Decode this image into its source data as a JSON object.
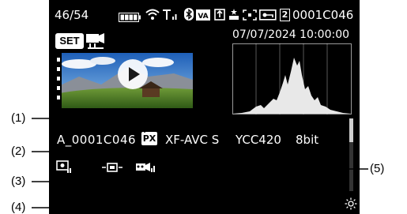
{
  "status_bar": {
    "image_counter": "46/54",
    "card_slot": "2",
    "file_id": "0001C046"
  },
  "datetime": "07/07/2024 10:00:00",
  "thumbnail": {
    "set_label": "SET"
  },
  "details": {
    "file_name": "A_0001C046",
    "proxy_badge": "PX",
    "codec": "XF-AVC S",
    "color_sampling": "YCC420",
    "bit_depth": "8bit"
  },
  "callouts": {
    "c1": "(1)",
    "c2": "(2)",
    "c3": "(3)",
    "c4": "(4)",
    "c5": "(5)"
  },
  "histogram": {
    "grid_lines": 4
  }
}
